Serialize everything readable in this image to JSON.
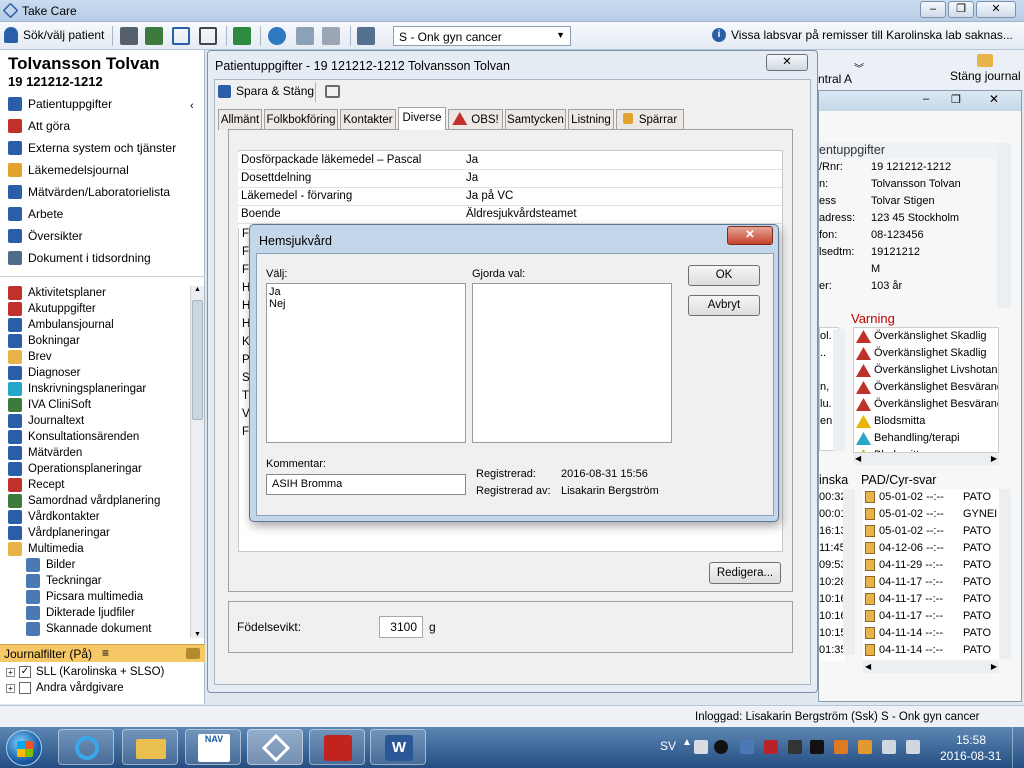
{
  "app": {
    "title": "Take Care"
  },
  "toolbar": {
    "search_patient": "Sök/välj patient",
    "unit_select": "S - Onk gyn cancer",
    "info_message": "Vissa labsvar på remisser till Karolinska lab saknas...",
    "close_journal": "Stäng journal",
    "central": "ntral A"
  },
  "patient": {
    "name": "Tolvansson Tolvan",
    "id": "19 121212-1212"
  },
  "left_nav": {
    "top": [
      "Patientuppgifter",
      "Att göra",
      "Externa system och tjänster",
      "Läkemedelsjournal",
      "Mätvärden/Laboratorielista",
      "Arbete",
      "Översikter",
      "Dokument i tidsordning"
    ],
    "list": [
      "Aktivitetsplaner",
      "Akutuppgifter",
      "Ambulansjournal",
      "Bokningar",
      "Brev",
      "Diagnoser",
      "Inskrivningsplaneringar",
      "IVA CliniSoft",
      "Journaltext",
      "Konsultationsärenden",
      "Mätvärden",
      "Operationsplaneringar",
      "Recept",
      "Samordnad vårdplanering",
      "Vårdkontakter",
      "Vårdplaneringar",
      "Multimedia"
    ],
    "multimedia": [
      "Bilder",
      "Teckningar",
      "Picsara multimedia",
      "Dikterade ljudfiler",
      "Skannade dokument"
    ],
    "journalfilter_title": "Journalfilter (På)",
    "filters": [
      "SLL (Karolinska + SLSO)",
      "Andra vårdgivare"
    ]
  },
  "patient_dialog": {
    "title": "Patientuppgifter - 19  121212-1212 Tolvansson Tolvan",
    "save_close": "Spara & Stäng",
    "tabs": [
      "Allmänt",
      "Folkbokföring",
      "Kontakter",
      "Diverse",
      "OBS!",
      "Samtycken",
      "Listning",
      "Spärrar"
    ],
    "rows": [
      {
        "label": "Dosförpackade läkemedel – Pascal",
        "value": "Ja"
      },
      {
        "label": "Dosettdelning",
        "value": "Ja"
      },
      {
        "label": "Läkemedel - förvaring",
        "value": "Ja på VC"
      },
      {
        "label": "Boende",
        "value": "Äldresjukvårdsteamet"
      }
    ],
    "row_initials": [
      "F",
      "F",
      "F",
      "H",
      "H",
      "H",
      "K",
      "P",
      "S",
      "T",
      "V",
      "F"
    ],
    "edit_button": "Redigera...",
    "birth_weight_label": "Födelsevikt:",
    "birth_weight_value": "3100",
    "birth_weight_unit": "g"
  },
  "modal": {
    "title": "Hemsjukvård",
    "choose_label": "Välj:",
    "options": [
      "Ja",
      "Nej"
    ],
    "chosen_label": "Gjorda val:",
    "ok": "OK",
    "cancel": "Avbryt",
    "comment_label": "Kommentar:",
    "comment_value": "ASIH Bromma",
    "registered_label": "Registrerad:",
    "registered_value": "2016-08-31 15:56",
    "registered_by_label": "Registrerad av:",
    "registered_by_value": "Lisakarin Bergström"
  },
  "right_window": {
    "section_title": "entuppgifter",
    "fields": [
      {
        "label": "/Rnr:",
        "value": "19  121212-1212"
      },
      {
        "label": "n:",
        "value": "Tolvansson Tolvan"
      },
      {
        "label": "ess",
        "value": "Tolvar Stigen"
      },
      {
        "label": "adress:",
        "value": "123 45 Stockholm"
      },
      {
        "label": "fon:",
        "value": "08-123456"
      },
      {
        "label": "lsedtm:",
        "value": "19121212"
      },
      {
        "label": "",
        "value": "M"
      },
      {
        "label": "er:",
        "value": "103 år"
      }
    ],
    "varning_title": "Varning",
    "left_snips": [
      "ol.",
      "..",
      "",
      "n,",
      "lu.",
      "en"
    ],
    "warnings": [
      "Överkänslighet Skadlig",
      "Överkänslighet Skadlig",
      "Överkänslighet Livshotan",
      "Överkänslighet Besvärand",
      "Överkänslighet Besvärand",
      "Blodsmitta",
      "Behandling/terapi",
      "Blodsmitta"
    ],
    "lab_title": "inska",
    "pad_title": "PAD/Cyr-svar",
    "times": [
      "00:32",
      "00:01",
      "16:13",
      "11:45",
      "09:53",
      "10:28",
      "10:16",
      "10:16",
      "10:15",
      "01:35"
    ],
    "pad_rows": [
      {
        "date": "05-01-02 --:--",
        "type": "PATO"
      },
      {
        "date": "05-01-02 --:--",
        "type": "GYNEI"
      },
      {
        "date": "05-01-02 --:--",
        "type": "PATO"
      },
      {
        "date": "04-12-06 --:--",
        "type": "PATO"
      },
      {
        "date": "04-11-29 --:--",
        "type": "PATO"
      },
      {
        "date": "04-11-17 --:--",
        "type": "PATO"
      },
      {
        "date": "04-11-17 --:--",
        "type": "PATO"
      },
      {
        "date": "04-11-17 --:--",
        "type": "PATO"
      },
      {
        "date": "04-11-14 --:--",
        "type": "PATO"
      },
      {
        "date": "04-11-14 --:--",
        "type": "PATO"
      }
    ]
  },
  "statusbar": {
    "logged_in": "Inloggad:  Lisakarin Bergström (Ssk) S - Onk gyn cancer"
  },
  "taskbar": {
    "lang": "SV",
    "time": "15:58",
    "date": "2016-08-31",
    "nav_label": "NAV"
  },
  "colors": {
    "accent": "#2a5ea8",
    "warning_red": "#c0312b",
    "warning_yellow": "#e8b500",
    "nav_cyan": "#26a7c9",
    "section_red": "#c00000"
  }
}
